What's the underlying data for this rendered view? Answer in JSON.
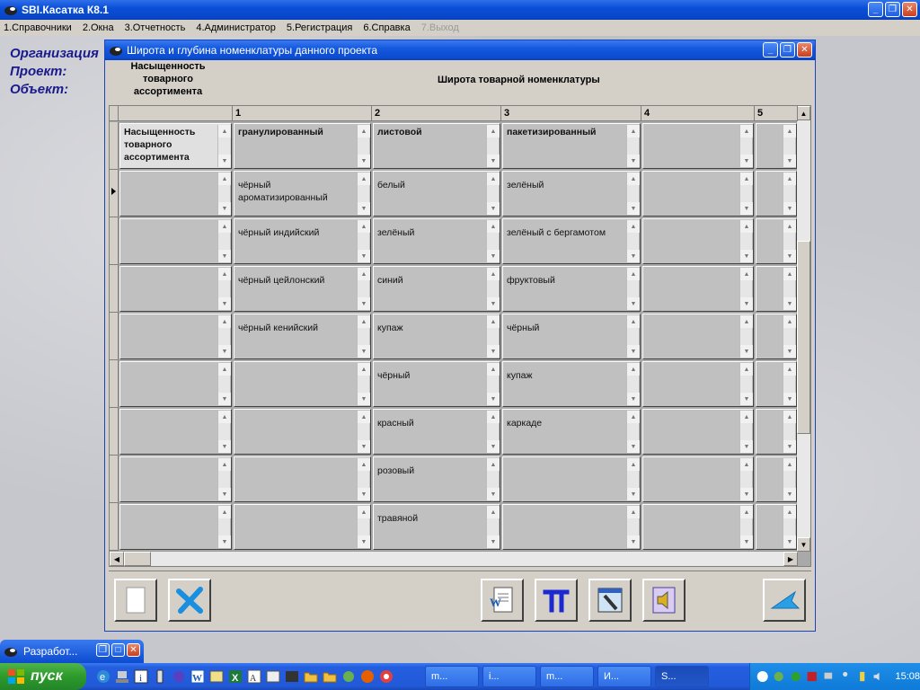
{
  "app": {
    "title": "SBI.Касатка К8.1",
    "menu": [
      "1.Справочники",
      "2.Окна",
      "3.Отчетность",
      "4.Администратор",
      "5.Регистрация",
      "6.Справка",
      "7.Выход"
    ]
  },
  "side_labels": [
    "Организация",
    "Проект:",
    "Объект:"
  ],
  "window": {
    "title": "Широта и глубина номенклатуры данного проекта",
    "left_header": "Насыщенность товарного ассортимента",
    "main_header": "Широта товарной номенклатуры",
    "columns": [
      "1",
      "2",
      "3",
      "4",
      "5"
    ],
    "header_row": [
      "Насыщенность товарного ассортимента",
      "гранулированный",
      "листовой",
      "пакетизированный",
      "",
      ""
    ],
    "rows": [
      [
        "",
        "чёрный ароматизированный",
        "белый",
        "зелёный",
        "",
        ""
      ],
      [
        "",
        "чёрный индийский",
        "зелёный",
        "зелёный с бергамотом",
        "",
        ""
      ],
      [
        "",
        "чёрный цейлонский",
        "синий",
        "фруктовый",
        "",
        ""
      ],
      [
        "",
        "чёрный кенийский",
        "купаж",
        "чёрный",
        "",
        ""
      ],
      [
        "",
        "",
        "чёрный",
        "купаж",
        "",
        ""
      ],
      [
        "",
        "",
        "красный",
        "каркаде",
        "",
        ""
      ],
      [
        "",
        "",
        "розовый",
        "",
        "",
        ""
      ],
      [
        "",
        "",
        "травяной",
        "",
        "",
        ""
      ]
    ]
  },
  "minimized": {
    "title": "Разработ..."
  },
  "taskbar": {
    "start": "пуск",
    "tasks": [
      "m...",
      "i...",
      "m...",
      "И...",
      "S..."
    ],
    "clock": "15:08"
  }
}
